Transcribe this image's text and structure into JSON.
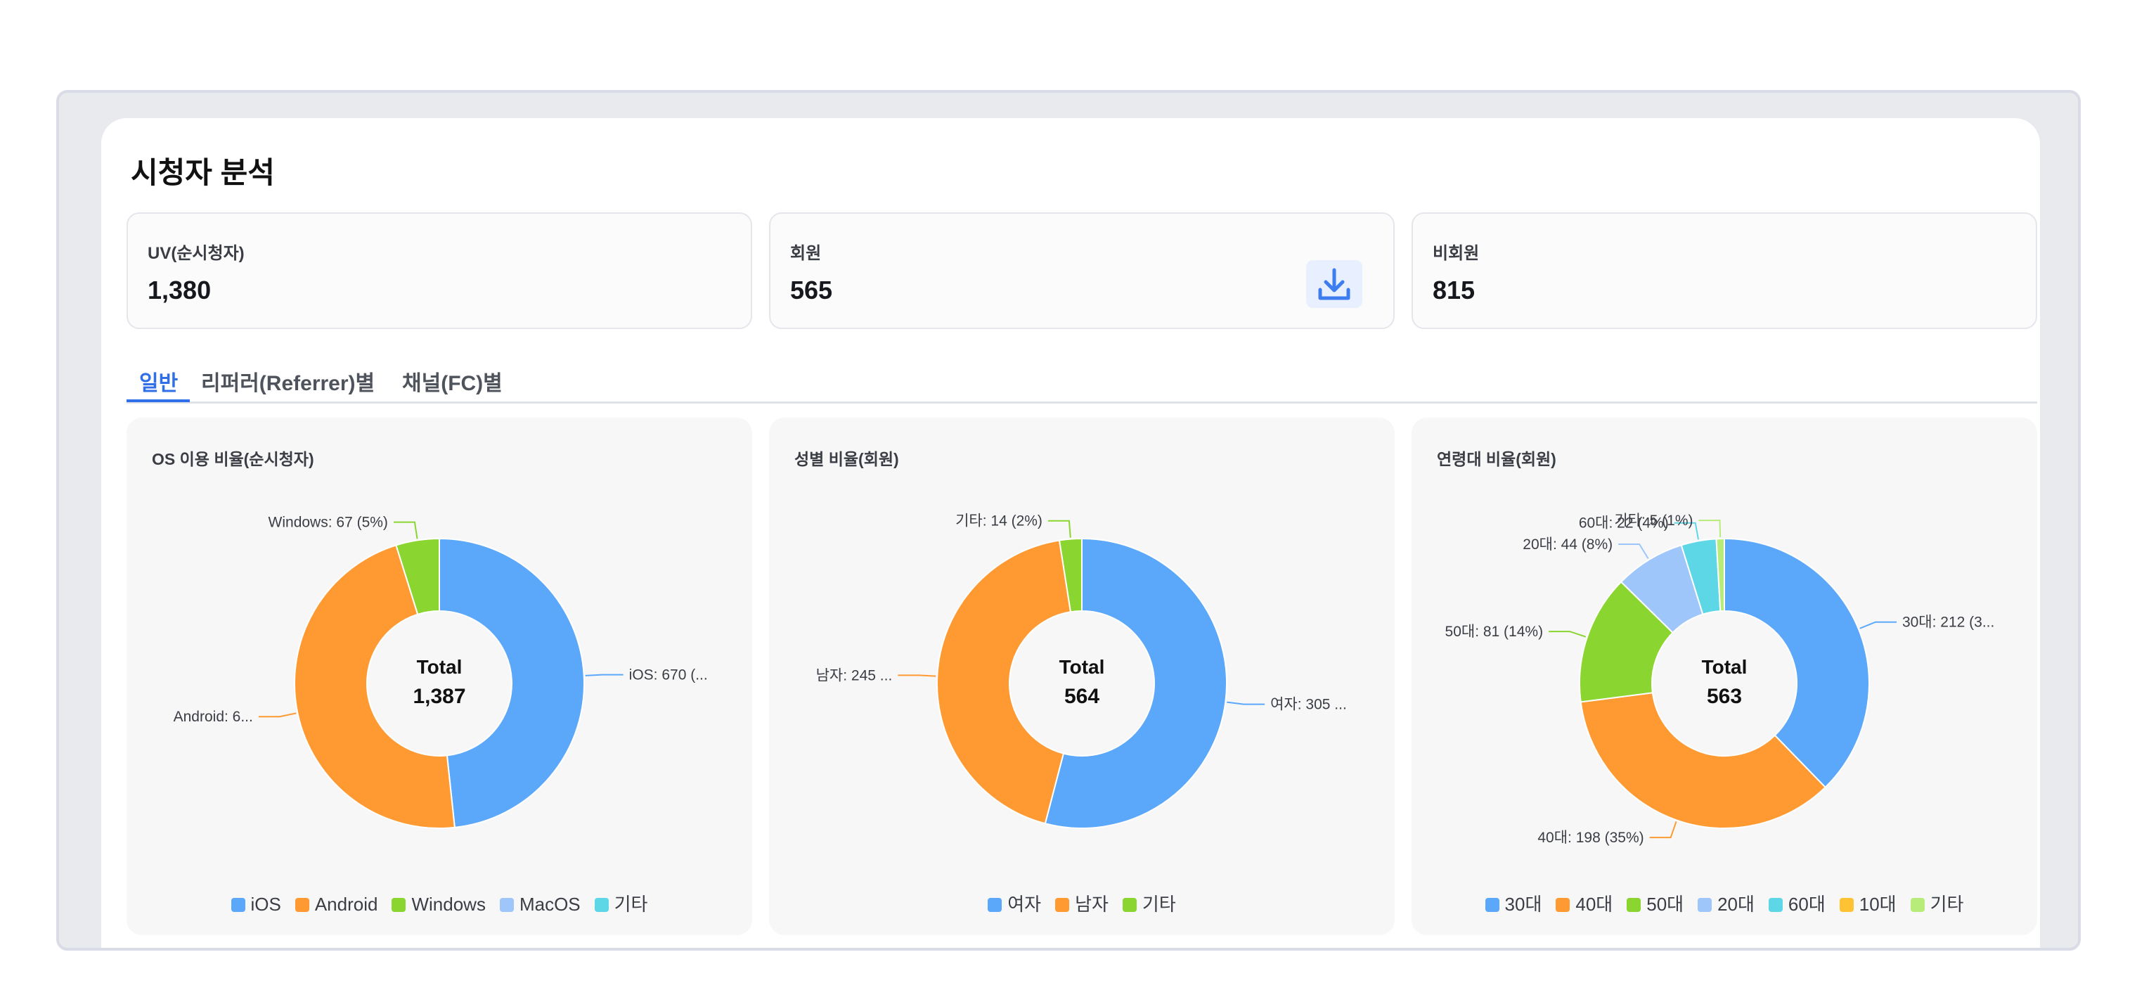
{
  "page": {
    "title": "시청자 분석"
  },
  "stats": [
    {
      "label": "UV(순시청자)",
      "value": "1,380"
    },
    {
      "label": "회원",
      "value": "565"
    },
    {
      "label": "비회원",
      "value": "815"
    }
  ],
  "tabs": [
    {
      "label": "일반",
      "active": true
    },
    {
      "label": "리퍼러(Referrer)별",
      "active": false
    },
    {
      "label": "채널(FC)별",
      "active": false
    }
  ],
  "icons": {
    "download": "download-icon"
  },
  "chart_data": [
    {
      "type": "pie",
      "title": "OS 이용 비율(순시청자)",
      "center_label": "Total",
      "center_value": "1,387",
      "categories": [
        "iOS",
        "Android",
        "Windows"
      ],
      "values": [
        670,
        650,
        67
      ],
      "colors": [
        "#5ba8fb",
        "#ff9a33",
        "#8ad52f"
      ],
      "labels": [
        "iOS: 670 (...",
        "Android: 6...",
        "Windows: 67 (5%)"
      ],
      "legend": [
        {
          "label": "iOS",
          "color": "#5ba8fb"
        },
        {
          "label": "Android",
          "color": "#ff9a33"
        },
        {
          "label": "Windows",
          "color": "#8ad52f"
        },
        {
          "label": "MacOS",
          "color": "#9fc6fb"
        },
        {
          "label": "기타",
          "color": "#5dd6e6"
        }
      ]
    },
    {
      "type": "pie",
      "title": "성별 비율(회원)",
      "center_label": "Total",
      "center_value": "564",
      "categories": [
        "여자",
        "남자",
        "기타"
      ],
      "values": [
        305,
        245,
        14
      ],
      "colors": [
        "#5ba8fb",
        "#ff9a33",
        "#8ad52f"
      ],
      "labels": [
        "여자: 305 ...",
        "남자: 245 ...",
        "기타: 14 (2%)"
      ],
      "legend": [
        {
          "label": "여자",
          "color": "#5ba8fb"
        },
        {
          "label": "남자",
          "color": "#ff9a33"
        },
        {
          "label": "기타",
          "color": "#8ad52f"
        }
      ]
    },
    {
      "type": "pie",
      "title": "연령대 비율(회원)",
      "center_label": "Total",
      "center_value": "563",
      "categories": [
        "30대",
        "40대",
        "50대",
        "20대",
        "60대",
        "기타"
      ],
      "values": [
        212,
        198,
        81,
        44,
        22,
        5
      ],
      "colors": [
        "#5ba8fb",
        "#ff9a33",
        "#8ad52f",
        "#9fc6fb",
        "#5dd6e6",
        "#b8ec7a"
      ],
      "labels": [
        "30대: 212 (3...",
        "40대: 198 (35%)",
        "50대: 81 (14%)",
        "20대: 44 (8%)",
        "60대: 22 (4%)",
        "기타: 5 (1%)"
      ],
      "legend": [
        {
          "label": "30대",
          "color": "#5ba8fb"
        },
        {
          "label": "40대",
          "color": "#ff9a33"
        },
        {
          "label": "50대",
          "color": "#8ad52f"
        },
        {
          "label": "20대",
          "color": "#9fc6fb"
        },
        {
          "label": "60대",
          "color": "#5dd6e6"
        },
        {
          "label": "10대",
          "color": "#ffc233"
        },
        {
          "label": "기타",
          "color": "#b8ec7a"
        }
      ]
    }
  ]
}
